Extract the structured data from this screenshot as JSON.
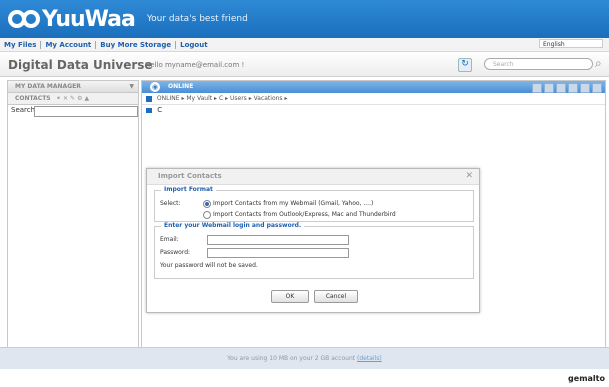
{
  "header": {
    "brand": "YuuWaa",
    "tagline": "Your data's best friend"
  },
  "topnav": {
    "items": [
      "My Files",
      "My Account",
      "Buy More Storage",
      "Logout"
    ],
    "language": "English"
  },
  "subbar": {
    "title": "Digital Data Universe",
    "hello": "Hello myname@email.com !",
    "search_placeholder": "Search"
  },
  "left": {
    "header": "MY DATA MANAGER",
    "contacts": "CONTACTS",
    "search_label": "Search:"
  },
  "right": {
    "status": "ONLINE",
    "breadcrumbs": [
      "ONLINE",
      "My Vault",
      "C",
      "Users",
      "Vacations"
    ],
    "drive": "C"
  },
  "modal": {
    "title": "Import Contacts",
    "format_legend": "Import Format",
    "select_label": "Select:",
    "option1": "Import Contacts from my Webmail (Gmail, Yahoo, ....)",
    "option2": "Import Contacts from Outlook/Express, Mac and Thunderbird",
    "webmail_legend": "Enter your Webmail login and password.",
    "email_label": "Email:",
    "password_label": "Password:",
    "note": "Your password will not be saved.",
    "ok": "OK",
    "cancel": "Cancel"
  },
  "footer": {
    "text": "You are using 10 MB on your 2 GB account",
    "link": "(details)",
    "vendor": "gemalto"
  },
  "colors": {
    "header": "#1b6fbd",
    "accent": "#1c6cc0"
  }
}
